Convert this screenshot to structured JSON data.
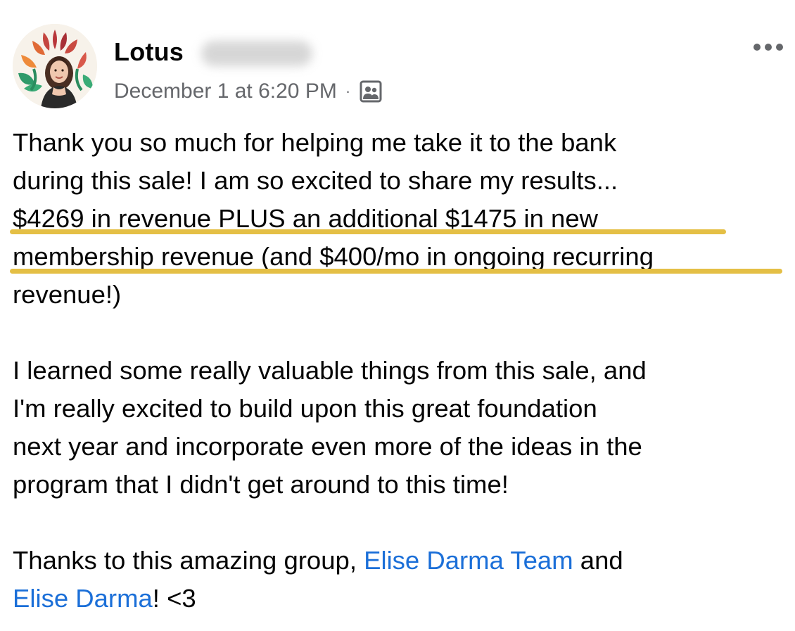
{
  "post": {
    "author": {
      "first_name": "Lotus",
      "avatar_icon": "profile-photo"
    },
    "timestamp": "December 1 at 6:20 PM",
    "separator": "·",
    "audience_icon": "group-audience-icon",
    "more_icon": "more-options-icon",
    "body": {
      "p1_line1": "Thank you so much for helping me take it to the bank",
      "p1_line2": "during this sale! I am so excited to share my results...",
      "p1_line3": "$4269 in revenue PLUS an additional $1475 in new",
      "p1_line4": "membership revenue (and $400/mo in ongoing recurring",
      "p1_line5": "revenue!)",
      "p2_line1": "I learned some really valuable things from this sale, and",
      "p2_line2": "I'm really excited to build upon this great foundation",
      "p2_line3": "next year and incorporate even more of the ideas in the",
      "p2_line4": "program that I didn't get around to this time!",
      "p3_line1_prefix": "Thanks to this amazing group, ",
      "p3_mention1": "Elise Darma Team",
      "p3_line1_suffix": " and",
      "p3_mention2": "Elise Darma",
      "p3_line2_suffix": "! <3"
    },
    "colors": {
      "highlight_underline": "#e4bf45",
      "mention_link": "#1b6fd8",
      "meta_text": "#65676b"
    }
  }
}
